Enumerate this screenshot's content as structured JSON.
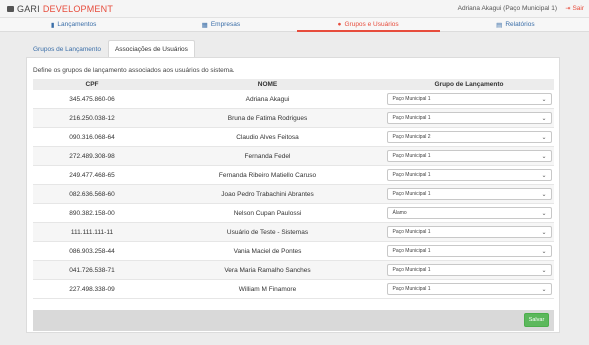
{
  "header": {
    "brand_part1": "GARI",
    "brand_part2": "DEVELOPMENT",
    "user": "Adriana Akagui (Paço Municipal 1)",
    "logout": "Sair"
  },
  "nav": {
    "items": [
      {
        "label": "Lançamentos",
        "icon": "book-icon"
      },
      {
        "label": "Empresas",
        "icon": "building-icon"
      },
      {
        "label": "Grupos e Usuários",
        "icon": "users-icon"
      },
      {
        "label": "Relatórios",
        "icon": "report-icon"
      }
    ],
    "active": "Grupos e Usuários"
  },
  "subtabs": [
    {
      "label": "Grupos de Lançamento"
    },
    {
      "label": "Associações de Usuários"
    }
  ],
  "panel": {
    "description": "Define os grupos de lançamento associados aos usuários do sistema.",
    "columns": [
      "CPF",
      "NOME",
      "Grupo de Lançamento"
    ],
    "rows": [
      {
        "cpf": "345.475.860-06",
        "nome": "Adriana Akagui",
        "grupo": "Paço Municipal 1"
      },
      {
        "cpf": "216.250.038-12",
        "nome": "Bruna de Fatima Rodrigues",
        "grupo": "Paço Municipal 1"
      },
      {
        "cpf": "090.316.068-64",
        "nome": "Claudio Alves Feitosa",
        "grupo": "Paço Municipal 2"
      },
      {
        "cpf": "272.489.308-98",
        "nome": "Fernanda Fedel",
        "grupo": "Paço Municipal 1"
      },
      {
        "cpf": "249.477.468-65",
        "nome": "Fernanda Ribeiro Matiello Caruso",
        "grupo": "Paço Municipal 1"
      },
      {
        "cpf": "082.636.568-60",
        "nome": "Joao Pedro Trabachini Abrantes",
        "grupo": "Paço Municipal 1"
      },
      {
        "cpf": "890.382.158-00",
        "nome": "Nelson Cupan Paulossi",
        "grupo": "Álamo"
      },
      {
        "cpf": "111.111.111-11",
        "nome": "Usuário de Teste - Sistemas",
        "grupo": "Paço Municipal 1"
      },
      {
        "cpf": "086.903.258-44",
        "nome": "Vania Maciel de Pontes",
        "grupo": "Paço Municipal 1"
      },
      {
        "cpf": "041.726.538-71",
        "nome": "Vera Maria Ramalho Sanches",
        "grupo": "Paço Municipal 1"
      },
      {
        "cpf": "227.498.338-09",
        "nome": "William M Finamore",
        "grupo": "Paço Municipal 1"
      }
    ],
    "save_label": "Salvar"
  },
  "colors": {
    "accent": "#e74c3c",
    "link": "#3a6ea8",
    "save": "#5cb85c"
  }
}
